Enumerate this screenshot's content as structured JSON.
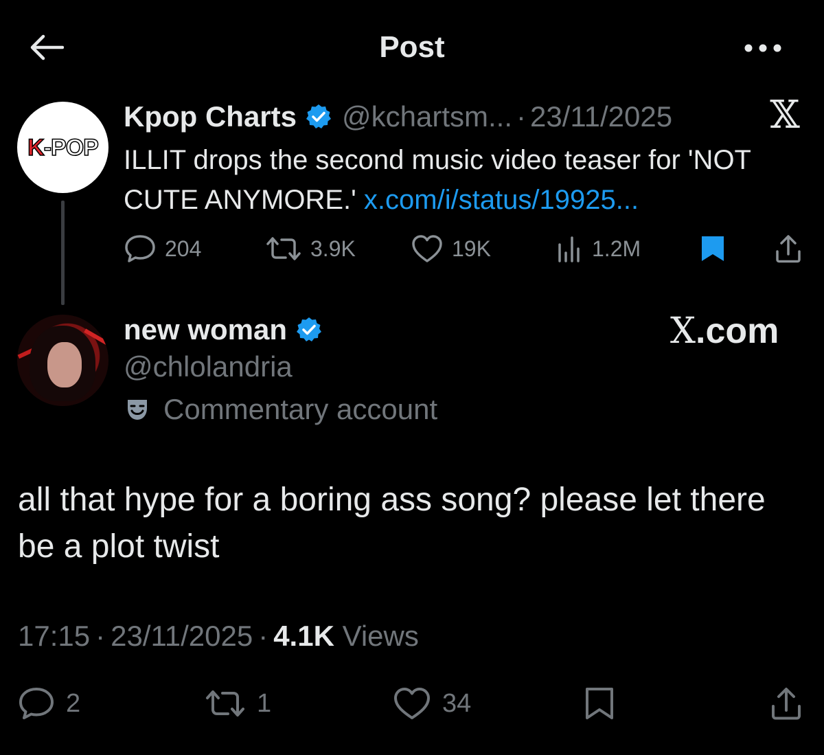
{
  "header": {
    "title": "Post",
    "back_icon": "arrow-left-icon",
    "more_icon": "more-horizontal-icon"
  },
  "quoted_post": {
    "avatar_logo": {
      "k": "K",
      "rest": "-POP"
    },
    "name": "Kpop Charts",
    "handle": "@kchartsm...",
    "separator": "·",
    "date": "23/11/2025",
    "source_icon": "x-logo-icon",
    "text": "ILLIT drops the second music video teaser for 'NOT CUTE ANYMORE.' ",
    "link": "x.com/i/status/19925...",
    "stats": {
      "replies": "204",
      "reposts": "3.9K",
      "likes": "19K",
      "views": "1.2M"
    },
    "accent_color": "#1d9bf0"
  },
  "main_post": {
    "name": "new woman",
    "handle": "@chlolandria",
    "label": "Commentary account",
    "watermark": {
      "x": "X",
      "rest": ".com"
    },
    "body": "all that hype for a boring ass song? please let there be a plot twist",
    "time": "17:15",
    "sep1": "·",
    "date": "23/11/2025",
    "sep2": "·",
    "views_count": "4.1K",
    "views_label": " Views",
    "stats": {
      "replies": "2",
      "reposts": "1",
      "likes": "34"
    }
  }
}
